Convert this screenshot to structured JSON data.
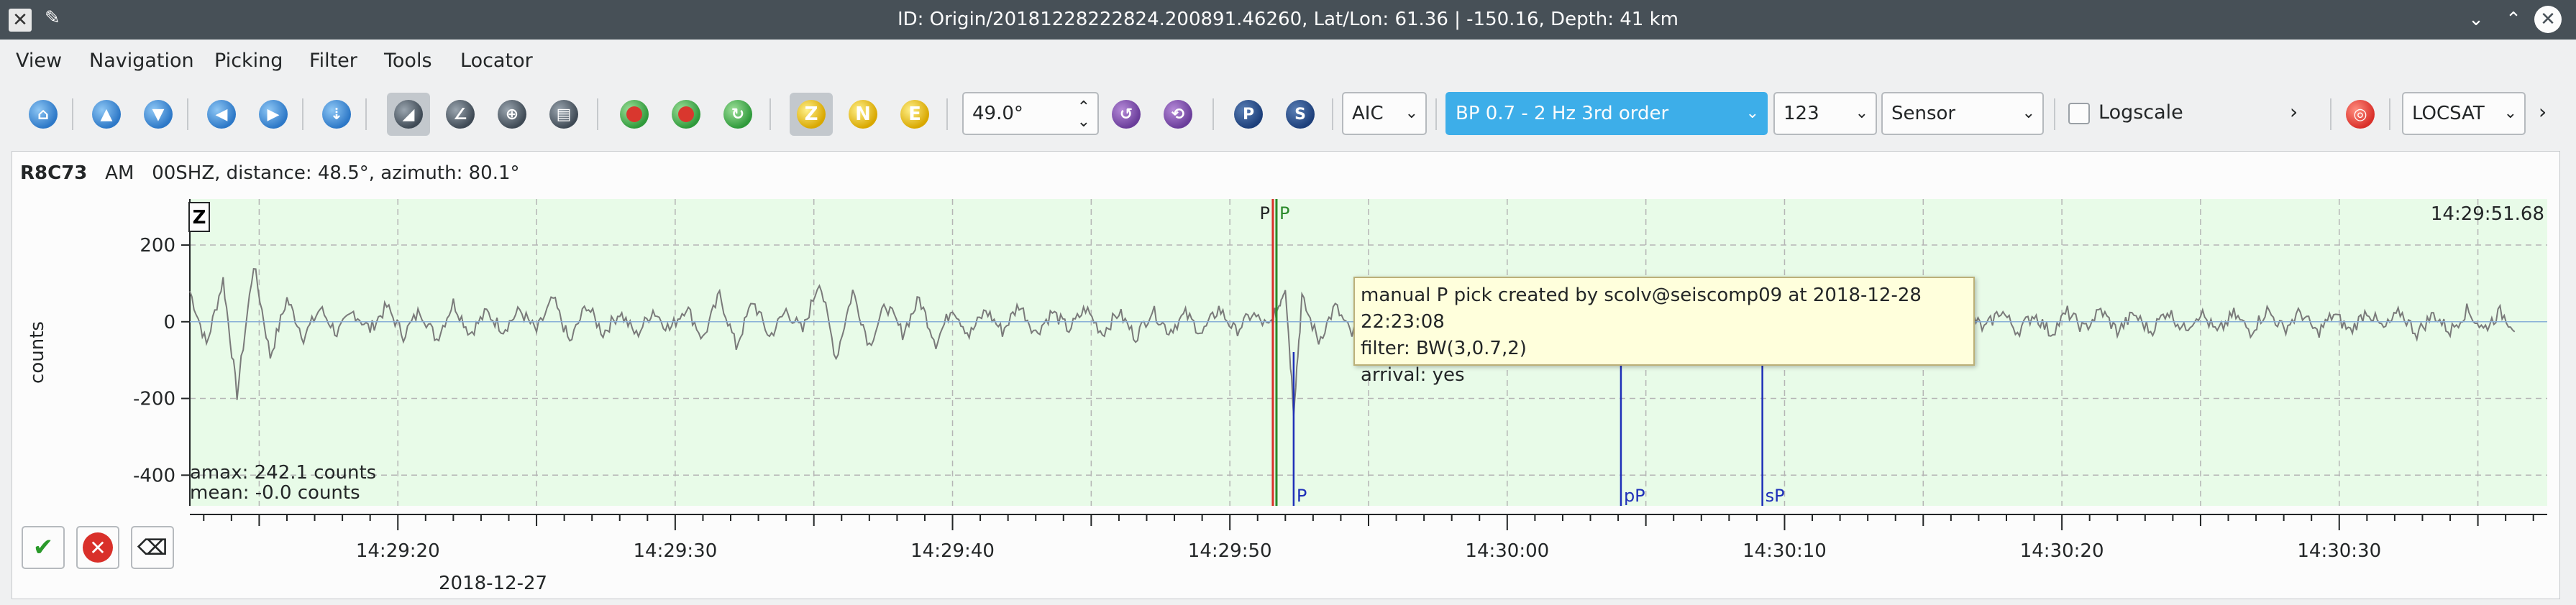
{
  "window": {
    "title": "ID: Origin/20181228222824.200891.46260, Lat/Lon: 61.36 | -150.16, Depth: 41 km"
  },
  "menu": [
    "View",
    "Navigation",
    "Picking",
    "Filter",
    "Tools",
    "Locator"
  ],
  "toolbar": {
    "component_buttons": [
      "Z",
      "N",
      "E"
    ],
    "pick_buttons": [
      "P",
      "S"
    ],
    "angle_value": "49.0°",
    "method_value": "AIC",
    "filter_value": "BP 0.7 - 2 Hz  3rd order",
    "number_value": "123",
    "unit_value": "Sensor",
    "logscale_label": "Logscale",
    "logscale_checked": false,
    "locator_value": "LOCSAT",
    "more_glyph": "›"
  },
  "trace": {
    "station": "R8C73",
    "network": "AM",
    "channel": "00SHZ",
    "distance_label": "distance: 48.5°",
    "azimuth_label": "azimuth: 80.1°",
    "component_label": "Z",
    "top_right_time": "14:29:51.68",
    "amax_label": "amax: 242.1 counts",
    "mean_label": "mean: -0.0 counts",
    "date_label": "2018-12-27",
    "buttons": {
      "accept_glyph": "✔",
      "reject_glyph": "✕",
      "close_glyph": "⌫"
    }
  },
  "tooltip": {
    "line1": "manual P pick created by scolv@seiscomp09 at 2018-12-28 22:23:08",
    "line2": "filter: BW(3,0.7,2)",
    "line3": "arrival: yes"
  },
  "colors": {
    "plot_bg": "#e8fbe8",
    "waveform": "#7a7a7a",
    "theoretical_pick": "#1e2fb8",
    "manual_pick": "#2a8a2a",
    "automatic_pick": "#d9302a",
    "filter_accent": "#3daee9"
  },
  "chart_data": {
    "type": "line",
    "ylabel": "counts",
    "ylim": [
      -480,
      320
    ],
    "yticks": [
      200,
      0,
      -200,
      -400
    ],
    "xlim_seconds": [
      12.5,
      97.5
    ],
    "time_base": "14:29:00",
    "xticks_seconds": [
      20,
      30,
      40,
      50,
      60,
      70,
      80,
      90
    ],
    "xtick_labels": [
      "14:29:20",
      "14:29:30",
      "14:29:40",
      "14:29:50",
      "14:30:00",
      "14:30:10",
      "14:30:20",
      "14:30:30"
    ],
    "picks": [
      {
        "label": "P",
        "t": 51.55,
        "kind": "automatic",
        "color": "#d9302a"
      },
      {
        "label": "P",
        "t": 51.68,
        "kind": "manual",
        "color": "#2a8a2a"
      },
      {
        "label": "P",
        "t": 52.3,
        "kind": "theoretical",
        "color": "#1e2fb8"
      },
      {
        "label": "pP",
        "t": 64.1,
        "kind": "theoretical",
        "color": "#1e2fb8"
      },
      {
        "label": "sP",
        "t": 69.2,
        "kind": "theoretical",
        "color": "#1e2fb8"
      }
    ],
    "series": [
      {
        "points_seconds": [
          12.5,
          13.1,
          13.7,
          14.2,
          14.8,
          15.4,
          16.0,
          16.6,
          17.2,
          17.8,
          18.4,
          19.0,
          19.6,
          20.2,
          20.8,
          21.4,
          22.0,
          22.6,
          23.2,
          23.8,
          24.4,
          25.0,
          25.6,
          26.2,
          26.8,
          27.4,
          28.0,
          28.6,
          29.2,
          29.8,
          30.4,
          31.0,
          31.6,
          32.2,
          32.8,
          33.4,
          34.0,
          34.6,
          35.2,
          35.8,
          36.4,
          37.0,
          37.6,
          38.2,
          38.8,
          39.4,
          40.0,
          40.6,
          41.2,
          41.8,
          42.4,
          43.0,
          43.6,
          44.2,
          44.8,
          45.4,
          46.0,
          46.6,
          47.2,
          47.8,
          48.4,
          49.0,
          49.6,
          50.2,
          50.8,
          51.4,
          51.7,
          52.0,
          52.3,
          52.6,
          53.2,
          53.8,
          54.4,
          55.0,
          55.6,
          56.2,
          56.8,
          57.4,
          58.0,
          58.6,
          59.2,
          59.8,
          60.4,
          61.0,
          61.6,
          62.2,
          62.8,
          63.4,
          64.0,
          64.6,
          65.2,
          65.8,
          66.4,
          67.0,
          67.6,
          68.2,
          68.8,
          69.4,
          70.0,
          70.6,
          71.2,
          71.8,
          72.4,
          73.0,
          73.6,
          74.2,
          74.8,
          75.4,
          76.0,
          76.6,
          77.2,
          77.8,
          78.4,
          79.0,
          79.6,
          80.2,
          80.8,
          81.4,
          82.0,
          82.6,
          83.2,
          83.8,
          84.4,
          85.0,
          85.6,
          86.2,
          86.8,
          87.4,
          88.0,
          88.6,
          89.2,
          89.8,
          90.4,
          91.0,
          91.6,
          92.2,
          92.8,
          93.4,
          94.0,
          94.6,
          95.2,
          95.8,
          96.4,
          97.0
        ],
        "values": [
          80,
          -60,
          110,
          -190,
          150,
          -90,
          60,
          -40,
          35,
          -30,
          25,
          -20,
          40,
          -35,
          30,
          -45,
          50,
          -30,
          25,
          -20,
          30,
          -25,
          60,
          -55,
          45,
          -30,
          25,
          -35,
          30,
          -20,
          40,
          -45,
          70,
          -65,
          55,
          -40,
          30,
          -25,
          110,
          -95,
          80,
          -60,
          45,
          -30,
          60,
          -55,
          40,
          -35,
          30,
          -25,
          45,
          -30,
          25,
          -20,
          35,
          -30,
          25,
          -40,
          30,
          -25,
          20,
          -30,
          35,
          -25,
          20,
          -15,
          30,
          95,
          -230,
          60,
          -50,
          40,
          -35,
          30,
          -25,
          20,
          -30,
          25,
          -20,
          35,
          -30,
          25,
          -20,
          30,
          -25,
          20,
          -30,
          25,
          -35,
          30,
          -25,
          20,
          -25,
          30,
          -30,
          25,
          -20,
          25,
          -30,
          20,
          -25,
          30,
          -20,
          25,
          -30,
          20,
          -25,
          30,
          -20,
          25,
          -20,
          30,
          -25,
          20,
          -30,
          25,
          -20,
          30,
          -25,
          20,
          -25,
          30,
          -20,
          25,
          -30,
          20,
          -25,
          30,
          -20,
          25,
          -30,
          20,
          -25,
          30,
          -20,
          25,
          -30,
          20,
          -25,
          30,
          -20,
          25,
          -20
        ]
      }
    ]
  }
}
